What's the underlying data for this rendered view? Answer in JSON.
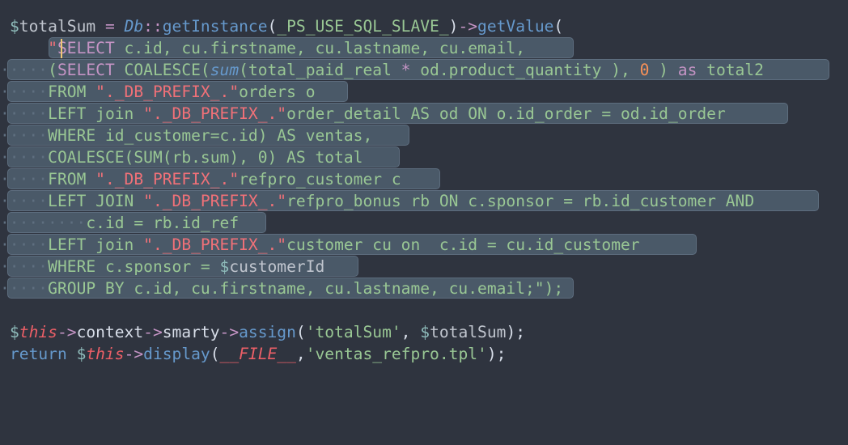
{
  "code": {
    "lines": [
      "$totalSum = Db::getInstance(_PS_USE_SQL_SLAVE_)->getValue(",
      "    \"SELECT c.id, cu.firstname, cu.lastname, cu.email,",
      "    (SELECT COALESCE(sum(total_paid_real * od.product_quantity ), 0 ) as total2",
      "    FROM \"._DB_PREFIX_.\"orders o",
      "    LEFT join \"._DB_PREFIX_.\"order_detail AS od ON o.id_order = od.id_order",
      "    WHERE id_customer=c.id) AS ventas,",
      "    COALESCE(SUM(rb.sum), 0) AS total",
      "    FROM \"._DB_PREFIX_.\"refpro_customer c",
      "    LEFT JOIN \"._DB_PREFIX_.\"refpro_bonus rb ON c.sponsor = rb.id_customer AND",
      "        c.id = rb.id_ref",
      "    LEFT join \"._DB_PREFIX_.\"customer cu on  c.id = cu.id_customer",
      "    WHERE c.sponsor = $customerId",
      "    GROUP BY c.id, cu.firstname, cu.lastname, cu.email;\");",
      "",
      "$this->context->smarty->assign('totalSum', $totalSum);",
      "return $this->display(__FILE__,'ventas_refpro.tpl');"
    ]
  },
  "colors": {
    "background": "#2f343f",
    "selection": "#4a5968",
    "caret": "#f0c674"
  }
}
